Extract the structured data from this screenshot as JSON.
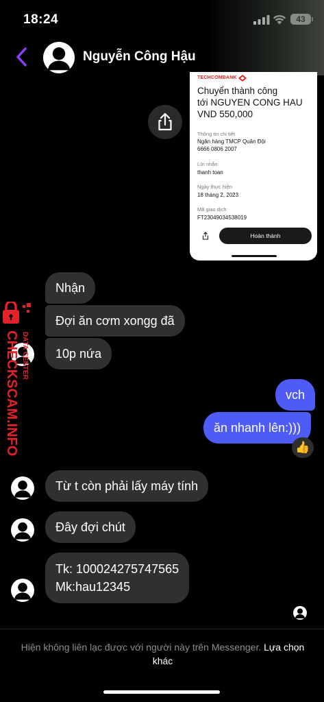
{
  "status_bar": {
    "time": "18:24",
    "battery": "43"
  },
  "header": {
    "contact_name": "Nguyễn Công Hậu"
  },
  "receipt": {
    "bank": "TECHCOMBANK",
    "title_lines": [
      "Chuyển thành công",
      "tới NGUYEN CONG HAU",
      "VND 550,000"
    ],
    "fields": [
      {
        "label": "Thông tin chi tiết",
        "value_lines": [
          "Ngân hàng TMCP Quân Đội",
          "6666 0806 2007"
        ]
      },
      {
        "label": "Lời nhắn",
        "value_lines": [
          "thanh toan"
        ]
      },
      {
        "label": "Ngày thực hiện",
        "value_lines": [
          "18 tháng 2, 2023"
        ]
      },
      {
        "label": "Mã giao dịch",
        "value_lines": [
          "FT23049034538019"
        ]
      }
    ],
    "done_button": "Hoàn thành"
  },
  "messages": {
    "m1": "Nhận",
    "m2": "Đợi ăn cơm xongg đã",
    "m3": "10p nứa",
    "m4": "vch",
    "m5": "ăn nhanh lên:)))",
    "m5_reaction": "👍",
    "m6": "Từ t còn phải lấy máy tính",
    "m7": "Đây đợi chút",
    "m8_line1": "Tk: 100024275747565",
    "m8_line2": "Mk:hau12345"
  },
  "watermark": {
    "line1": "DATA CENTER",
    "line2": "CHECKSCAM.INFO"
  },
  "footer": {
    "notice": "Hiện không liên lạc được với người này trên Messenger.",
    "link": "Lựa chọn khác"
  },
  "colors": {
    "outgoing": "#4e5bf5",
    "incoming": "#303030",
    "accent": "#8a3ffc",
    "watermark": "#e3232a"
  },
  "icons": [
    "back-chevron-icon",
    "share-icon",
    "avatar-icon",
    "thumbs-up-icon",
    "lock-icon"
  ]
}
